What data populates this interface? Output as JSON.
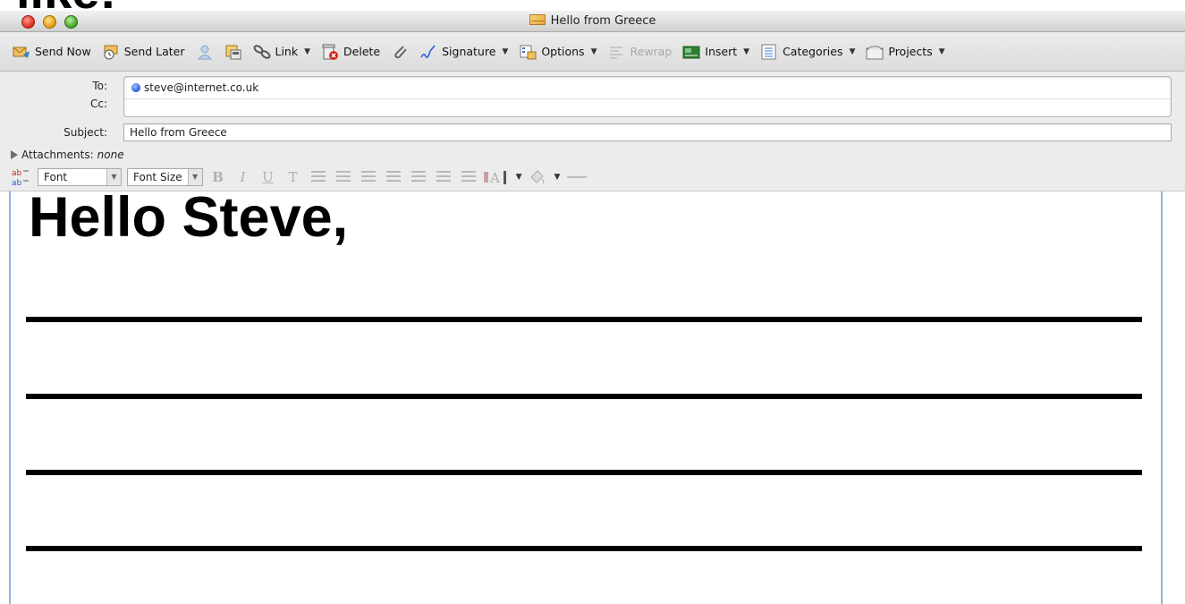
{
  "overlay_heading": "like:",
  "window": {
    "title": "Hello from Greece",
    "icon": "envelope-icon"
  },
  "toolbar": {
    "items": [
      {
        "label": "Send Now",
        "icon": "send-now-icon",
        "dropdown": false,
        "enabled": true
      },
      {
        "label": "Send Later",
        "icon": "send-later-icon",
        "dropdown": false,
        "enabled": true
      },
      {
        "label": "",
        "icon": "address-book-icon",
        "dropdown": false,
        "enabled": true
      },
      {
        "label": "",
        "icon": "contacts-card-icon",
        "dropdown": false,
        "enabled": true
      },
      {
        "label": "Link",
        "icon": "link-icon",
        "dropdown": true,
        "enabled": true
      },
      {
        "label": "Delete",
        "icon": "delete-icon",
        "dropdown": false,
        "enabled": true
      },
      {
        "label": "",
        "icon": "attachment-icon",
        "dropdown": false,
        "enabled": true
      },
      {
        "label": "Signature",
        "icon": "signature-icon",
        "dropdown": true,
        "enabled": true
      },
      {
        "label": "Options",
        "icon": "options-icon",
        "dropdown": true,
        "enabled": true
      },
      {
        "label": "Rewrap",
        "icon": "rewrap-icon",
        "dropdown": false,
        "enabled": false
      },
      {
        "label": "Insert",
        "icon": "insert-icon",
        "dropdown": true,
        "enabled": true
      },
      {
        "label": "Categories",
        "icon": "categories-icon",
        "dropdown": true,
        "enabled": true
      },
      {
        "label": "Projects",
        "icon": "projects-icon",
        "dropdown": true,
        "enabled": true
      }
    ]
  },
  "headers": {
    "to_label": "To:",
    "to_value": "steve@internet.co.uk",
    "cc_label": "Cc:",
    "cc_value": "",
    "subject_label": "Subject:",
    "subject_value": "Hello from Greece",
    "attachments_label": "Attachments:",
    "attachments_value": "none"
  },
  "formatbar": {
    "font_label": "Font",
    "font_size_label": "Font Size",
    "bold": "B",
    "italic": "I",
    "underline": "U",
    "text_style": "T"
  },
  "body": {
    "greeting": "Hello Steve,",
    "line_count": 4
  }
}
